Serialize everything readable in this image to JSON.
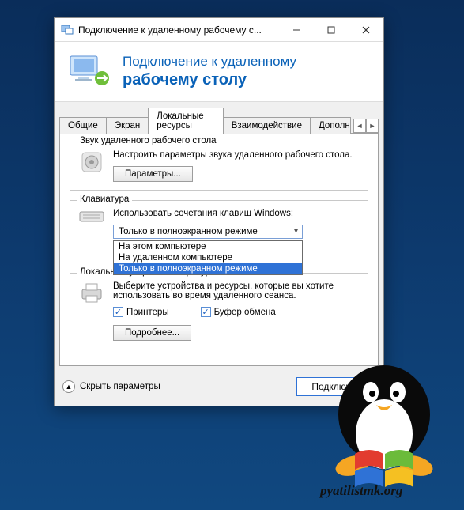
{
  "window": {
    "title": "Подключение к удаленному рабочему с...",
    "banner_line1": "Подключение к удаленному",
    "banner_line2": "рабочему столу"
  },
  "tabs": {
    "items": [
      "Общие",
      "Экран",
      "Локальные ресурсы",
      "Взаимодействие",
      "Дополни"
    ],
    "active_index": 2
  },
  "audio_group": {
    "title": "Звук удаленного рабочего стола",
    "desc": "Настроить параметры звука удаленного рабочего стола.",
    "button": "Параметры..."
  },
  "keyboard_group": {
    "title": "Клавиатура",
    "label": "Использовать сочетания клавиш Windows:",
    "selected": "Только в полноэкранном режиме",
    "options": [
      "На этом компьютере",
      "На удаленном компьютере",
      "Только в полноэкранном режиме"
    ],
    "selected_index": 2
  },
  "devices_group": {
    "title": "Локальные устройства и ресурсы",
    "desc": "Выберите устройства и ресурсы, которые вы хотите использовать во время удаленного сеанса.",
    "check_printers": "Принтеры",
    "check_clipboard": "Буфер обмена",
    "button": "Подробнее..."
  },
  "footer": {
    "hide": "Скрыть параметры",
    "connect": "Подключит"
  },
  "watermark": {
    "text": "pyatilistmk.org"
  }
}
